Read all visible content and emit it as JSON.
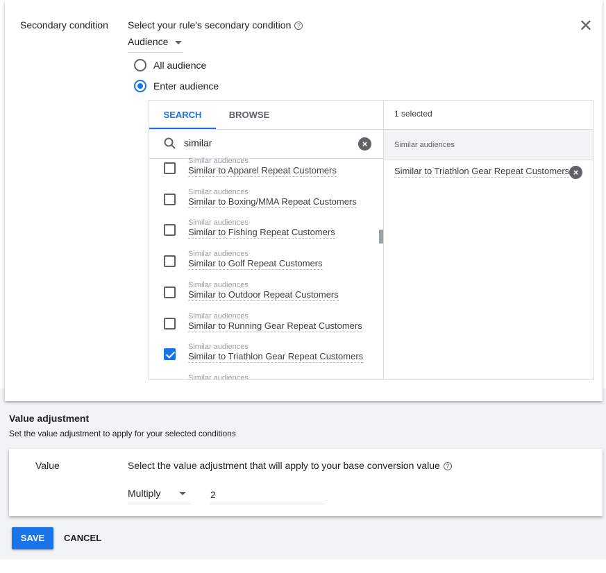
{
  "secondary": {
    "label": "Secondary condition",
    "prompt": "Select your rule's secondary condition",
    "dropdown": "Audience",
    "radios": [
      {
        "label": "All audience",
        "selected": false
      },
      {
        "label": "Enter audience",
        "selected": true
      }
    ]
  },
  "picker": {
    "tabs": [
      "SEARCH",
      "BROWSE"
    ],
    "active_tab": "SEARCH",
    "search_value": "similar",
    "items": [
      {
        "category": "Similar audiences",
        "name": "Similar to  Apparel Repeat Customers",
        "checked": false
      },
      {
        "category": "Similar audiences",
        "name": "Similar to  Boxing/MMA Repeat Customers",
        "checked": false
      },
      {
        "category": "Similar audiences",
        "name": "Similar to  Fishing Repeat Customers",
        "checked": false
      },
      {
        "category": "Similar audiences",
        "name": "Similar to  Golf Repeat Customers",
        "checked": false
      },
      {
        "category": "Similar audiences",
        "name": "Similar to  Outdoor Repeat Customers",
        "checked": false
      },
      {
        "category": "Similar audiences",
        "name": "Similar to  Running Gear Repeat Customers",
        "checked": false
      },
      {
        "category": "Similar audiences",
        "name": "Similar to  Triathlon Gear Repeat Customers",
        "checked": true
      },
      {
        "category": "Similar audiences",
        "name": "",
        "checked": false
      }
    ],
    "selected_count": "1 selected",
    "selected_group": "Similar audiences",
    "selected_items": [
      "Similar to Triathlon Gear Repeat Customers"
    ]
  },
  "value_adjustment": {
    "title": "Value adjustment",
    "subtitle": "Set the value adjustment to apply for your selected conditions",
    "label": "Value",
    "prompt": "Select the value adjustment that will apply to your base conversion value",
    "operation": "Multiply",
    "amount": "2"
  },
  "actions": {
    "save": "SAVE",
    "cancel": "CANCEL"
  },
  "colors": {
    "accent": "#1a73e8",
    "background": "#f1f3f4"
  }
}
